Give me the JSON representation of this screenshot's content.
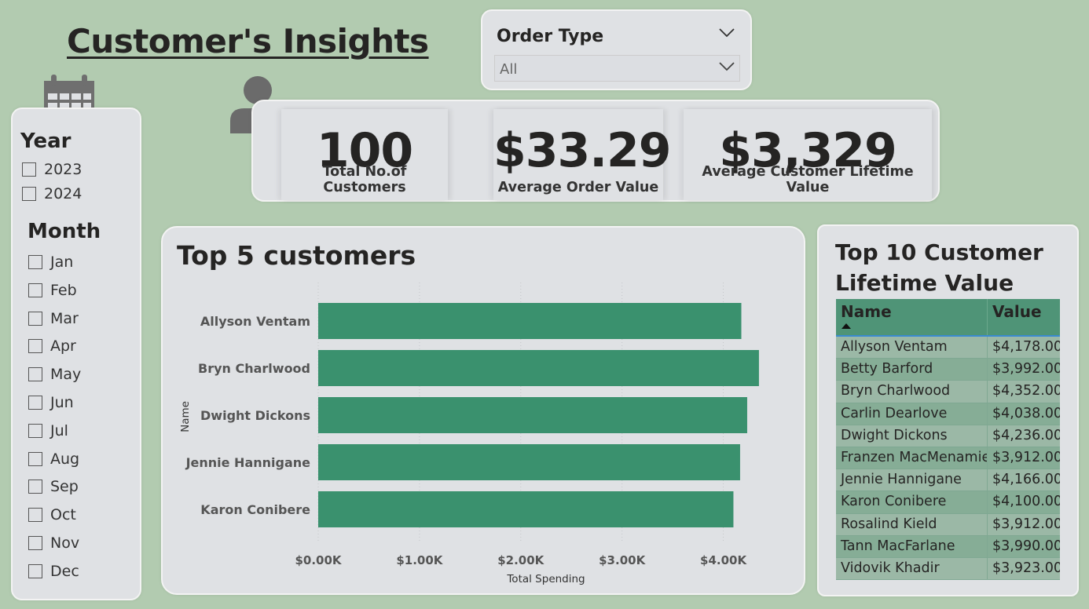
{
  "page": {
    "title": "Customer's Insights"
  },
  "order_type": {
    "label": "Order Type",
    "selected": "All"
  },
  "year_slicer": {
    "title": "Year",
    "options": [
      "2023",
      "2024"
    ]
  },
  "month_slicer": {
    "title": "Month",
    "options": [
      "Jan",
      "Feb",
      "Mar",
      "Apr",
      "May",
      "Jun",
      "Jul",
      "Aug",
      "Sep",
      "Oct",
      "Nov",
      "Dec"
    ]
  },
  "kpis": [
    {
      "value": "100",
      "label": "Total No.of Customers"
    },
    {
      "value": "$33.29",
      "label": "Average Order Value"
    },
    {
      "value": "$3,329",
      "label": "Average Customer Lifetime Value"
    }
  ],
  "top5": {
    "title": "Top 5 customers"
  },
  "top10": {
    "title_line1": "Top 10 Customer",
    "title_line2": "Lifetime Value",
    "headers": [
      "Name",
      "Value"
    ],
    "rows": [
      [
        "Allyson Ventam",
        "$4,178.00"
      ],
      [
        "Betty Barford",
        "$3,992.00"
      ],
      [
        "Bryn Charlwood",
        "$4,352.00"
      ],
      [
        "Carlin Dearlove",
        "$4,038.00"
      ],
      [
        "Dwight Dickons",
        "$4,236.00"
      ],
      [
        "Franzen MacMenamie",
        "$3,912.00"
      ],
      [
        "Jennie Hannigane",
        "$4,166.00"
      ],
      [
        "Karon Conibere",
        "$4,100.00"
      ],
      [
        "Rosalind Kield",
        "$3,912.00"
      ],
      [
        "Tann MacFarlane",
        "$3,990.00"
      ],
      [
        "Vidovik Khadir",
        "$3,923.00"
      ]
    ]
  },
  "colors": {
    "bar": "#3a916e",
    "background": "#b2cbb0",
    "card": "#dfe1e4"
  },
  "chart_data": {
    "type": "bar",
    "orientation": "horizontal",
    "title": "Top 5 customers",
    "xlabel": "Total Spending",
    "ylabel": "Name",
    "categories": [
      "Allyson Ventam",
      "Bryn Charlwood",
      "Dwight Dickons",
      "Jennie Hannigane",
      "Karon Conibere"
    ],
    "values": [
      4178,
      4352,
      4236,
      4166,
      4100
    ],
    "xlim": [
      0,
      4500
    ],
    "xticks": [
      0,
      1000,
      2000,
      3000,
      4000
    ],
    "xtick_labels": [
      "$0.00K",
      "$1.00K",
      "$2.00K",
      "$3.00K",
      "$4.00K"
    ],
    "grid": true,
    "legend": "none"
  }
}
